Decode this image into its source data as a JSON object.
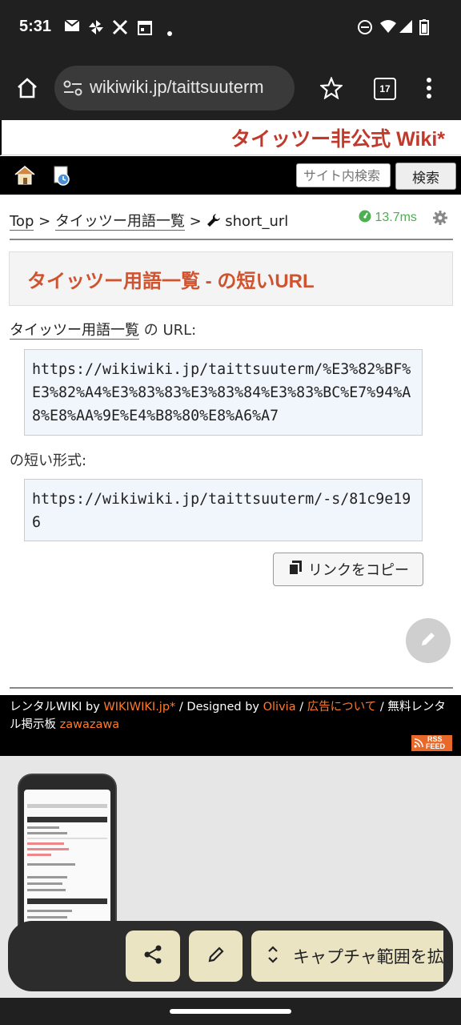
{
  "status": {
    "time": "5:31"
  },
  "browser": {
    "url": "wikiwiki.jp/taittsuuterm",
    "tab_count": "17"
  },
  "site": {
    "title": "タイッツー非公式 Wiki*"
  },
  "nav": {
    "search_placeholder": "サイト内検索",
    "search_button": "検索"
  },
  "breadcrumb": {
    "top": "Top",
    "sep1": ">",
    "parent": "タイッツー用語一覧",
    "sep2": ">",
    "current": "short_url"
  },
  "load_time": "13.7ms",
  "main": {
    "heading": "タイッツー用語一覧 - の短いURL",
    "url_label_link": "タイッツー用語一覧",
    "url_label_rest": " の URL:",
    "full_url": "https://wikiwiki.jp/taittsuuterm/%E3%82%BF%E3%82%A4%E3%83%83%E3%83%84%E3%83%BC%E7%94%A8%E8%AA%9E%E4%B8%80%E8%A6%A7",
    "short_label": "の短い形式:",
    "short_url": "https://wikiwiki.jp/taittsuuterm/-s/81c9e196",
    "copy_button": "リンクをコピー"
  },
  "footer": {
    "rental": "レンタルWIKI by",
    "wikiwiki": "WIKIWIKI.jp*",
    "sep1": "/",
    "designed": "Designed by",
    "olivia": "Olivia",
    "sep2": "/",
    "ads": "広告について",
    "sep3": "/",
    "bbs": "無料レンタル掲示板",
    "zawazawa": "zawazawa",
    "rss_line1": "RSS",
    "rss_line2": "FEED"
  },
  "capture_toolbar": {
    "expand_label": "キャプチャ範囲を拡"
  },
  "colors": {
    "accent": "#d0532f",
    "title": "#c0392b",
    "footer_link": "#ff7a2a",
    "load_time": "#4caf50",
    "toolbar_button": "#ebe4c3"
  }
}
